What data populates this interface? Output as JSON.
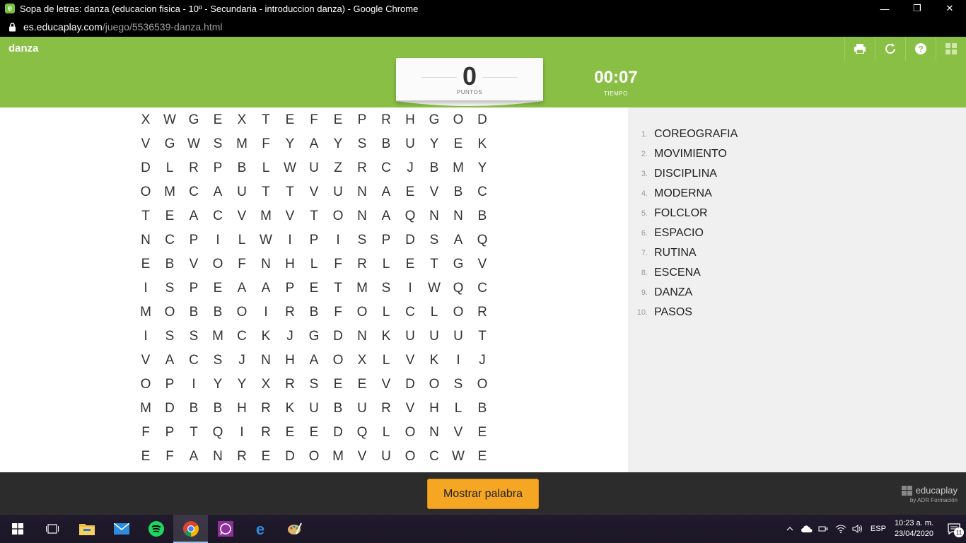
{
  "browser": {
    "window_title": "Sopa de letras: danza (educacion fisica - 10º - Secundaria - introduccion danza) - Google Chrome",
    "url_host": "es.educaplay.com",
    "url_path": "/juego/5536539-danza.html",
    "controls": {
      "minimize": "—",
      "maximize": "❐",
      "close": "✕"
    }
  },
  "app": {
    "title": "danza",
    "header_icons": [
      "print-icon",
      "restart-icon",
      "help-icon",
      "grid-menu-icon"
    ],
    "accent_color": "#88bf44"
  },
  "score": {
    "value": "0",
    "label": "PUNTOS"
  },
  "timer": {
    "value": "00:07",
    "label": "TIEMPO"
  },
  "grid": [
    [
      "X",
      "W",
      "G",
      "E",
      "X",
      "T",
      "E",
      "F",
      "E",
      "P",
      "R",
      "H",
      "G",
      "O",
      "D"
    ],
    [
      "V",
      "G",
      "W",
      "S",
      "M",
      "F",
      "Y",
      "A",
      "Y",
      "S",
      "B",
      "U",
      "Y",
      "E",
      "K"
    ],
    [
      "D",
      "L",
      "R",
      "P",
      "B",
      "L",
      "W",
      "U",
      "Z",
      "R",
      "C",
      "J",
      "B",
      "M",
      "Y"
    ],
    [
      "O",
      "M",
      "C",
      "A",
      "U",
      "T",
      "T",
      "V",
      "U",
      "N",
      "A",
      "E",
      "V",
      "B",
      "C"
    ],
    [
      "T",
      "E",
      "A",
      "C",
      "V",
      "M",
      "V",
      "T",
      "O",
      "N",
      "A",
      "Q",
      "N",
      "N",
      "B"
    ],
    [
      "N",
      "C",
      "P",
      "I",
      "L",
      "W",
      "I",
      "P",
      "I",
      "S",
      "P",
      "D",
      "S",
      "A",
      "Q"
    ],
    [
      "E",
      "B",
      "V",
      "O",
      "F",
      "N",
      "H",
      "L",
      "F",
      "R",
      "L",
      "E",
      "T",
      "G",
      "V"
    ],
    [
      "I",
      "S",
      "P",
      "E",
      "A",
      "A",
      "P",
      "E",
      "T",
      "M",
      "S",
      "I",
      "W",
      "Q",
      "C"
    ],
    [
      "M",
      "O",
      "B",
      "B",
      "O",
      "I",
      "R",
      "B",
      "F",
      "O",
      "L",
      "C",
      "L",
      "O",
      "R"
    ],
    [
      "I",
      "S",
      "S",
      "M",
      "C",
      "K",
      "J",
      "G",
      "D",
      "N",
      "K",
      "U",
      "U",
      "U",
      "T"
    ],
    [
      "V",
      "A",
      "C",
      "S",
      "J",
      "N",
      "H",
      "A",
      "O",
      "X",
      "L",
      "V",
      "K",
      "I",
      "J"
    ],
    [
      "O",
      "P",
      "I",
      "Y",
      "Y",
      "X",
      "R",
      "S",
      "E",
      "E",
      "V",
      "D",
      "O",
      "S",
      "O"
    ],
    [
      "M",
      "D",
      "B",
      "B",
      "H",
      "R",
      "K",
      "U",
      "B",
      "U",
      "R",
      "V",
      "H",
      "L",
      "B"
    ],
    [
      "F",
      "P",
      "T",
      "Q",
      "I",
      "R",
      "E",
      "E",
      "D",
      "Q",
      "L",
      "O",
      "N",
      "V",
      "E"
    ],
    [
      "E",
      "F",
      "A",
      "N",
      "R",
      "E",
      "D",
      "O",
      "M",
      "V",
      "U",
      "O",
      "C",
      "W",
      "E"
    ]
  ],
  "words": [
    {
      "num": "1.",
      "text": "COREOGRAFIA"
    },
    {
      "num": "2.",
      "text": "MOVIMIENTO"
    },
    {
      "num": "3.",
      "text": "DISCIPLINA"
    },
    {
      "num": "4.",
      "text": "MODERNA"
    },
    {
      "num": "5.",
      "text": "FOLCLOR"
    },
    {
      "num": "6.",
      "text": "ESPACIO"
    },
    {
      "num": "7.",
      "text": "RUTINA"
    },
    {
      "num": "8.",
      "text": "ESCENA"
    },
    {
      "num": "9.",
      "text": "DANZA"
    },
    {
      "num": "10.",
      "text": "PASOS"
    }
  ],
  "footer": {
    "show_word_label": "Mostrar palabra",
    "brand": "educaplay",
    "brand_sub": "by ADR Formación"
  },
  "taskbar": {
    "apps": [
      "windows-start-icon",
      "task-view-icon",
      "file-explorer-icon",
      "mail-icon",
      "spotify-icon",
      "chrome-icon",
      "whatsapp-icon",
      "edge-icon",
      "paint-icon"
    ],
    "active_app": "chrome-icon",
    "language": "ESP",
    "time": "10:23 a. m.",
    "date": "23/04/2020",
    "notification_count": "11"
  }
}
